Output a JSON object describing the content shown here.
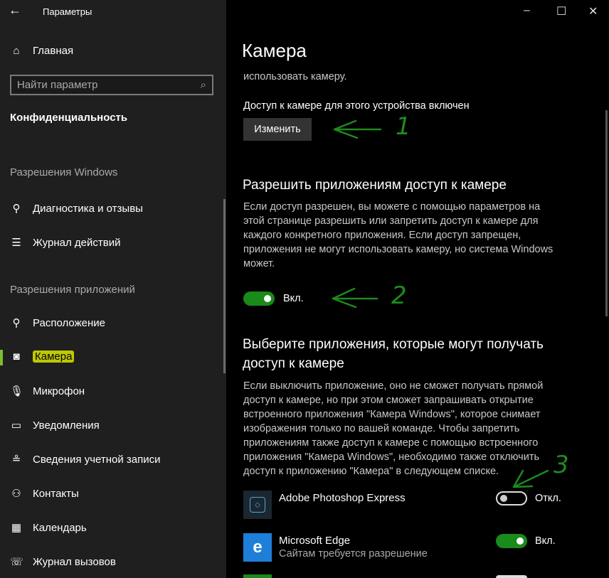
{
  "window": {
    "title": "Параметры",
    "minimize": "–",
    "maximize": "☐",
    "close": "✕"
  },
  "sidebar": {
    "home": "Главная",
    "search_placeholder": "Найти параметр",
    "section": "Конфиденциальность",
    "group_windows": "Разрешения Windows",
    "windows_items": [
      {
        "label": "Диагностика и отзывы",
        "icon": "feedback-icon"
      },
      {
        "label": "Журнал действий",
        "icon": "activity-icon"
      }
    ],
    "group_apps": "Разрешения приложений",
    "app_items": [
      {
        "label": "Расположение"
      },
      {
        "label": "Камера",
        "selected": true
      },
      {
        "label": "Микрофон"
      },
      {
        "label": "Уведомления"
      },
      {
        "label": "Сведения учетной записи"
      },
      {
        "label": "Контакты"
      },
      {
        "label": "Календарь"
      },
      {
        "label": "Журнал вызовов"
      }
    ]
  },
  "main": {
    "title": "Камера",
    "cut_text": "использовать камеру.",
    "device_status": "Доступ к камере для этого устройства включен",
    "change_button": "Изменить",
    "allow_heading": "Разрешить приложениям доступ к камере",
    "allow_text": "Если доступ разрешен, вы можете с помощью параметров на этой странице разрешить или запретить доступ к камере для каждого конкретного приложения. Если доступ запрещен, приложения не могут использовать камеру, но система Windows может.",
    "allow_toggle": {
      "on": true,
      "label": "Вкл."
    },
    "choose_heading": "Выберите приложения, которые могут получать доступ к камере",
    "choose_text": "Если выключить приложение, оно не сможет получать прямой доступ к камере, но при этом сможет запрашивать открытие встроенного приложения \"Камера Windows\", которое снимает изображения только по вашей команде. Чтобы запретить приложениям также доступ к камере с помощью встроенного приложения \"Камера Windows\", необходимо также отключить доступ к приложению \"Камера\" в следующем списке.",
    "apps": [
      {
        "name": "Adobe Photoshop Express",
        "sub": "",
        "on": false,
        "label": "Откл.",
        "color": "#1b2730"
      },
      {
        "name": "Microsoft Edge",
        "sub": "Сайтам требуется разрешение",
        "on": true,
        "label": "Вкл.",
        "color": "#1e7fd8"
      }
    ]
  },
  "annotations": {
    "one": "1",
    "two": "2",
    "three": "3",
    "color": "#1e8a1e"
  }
}
